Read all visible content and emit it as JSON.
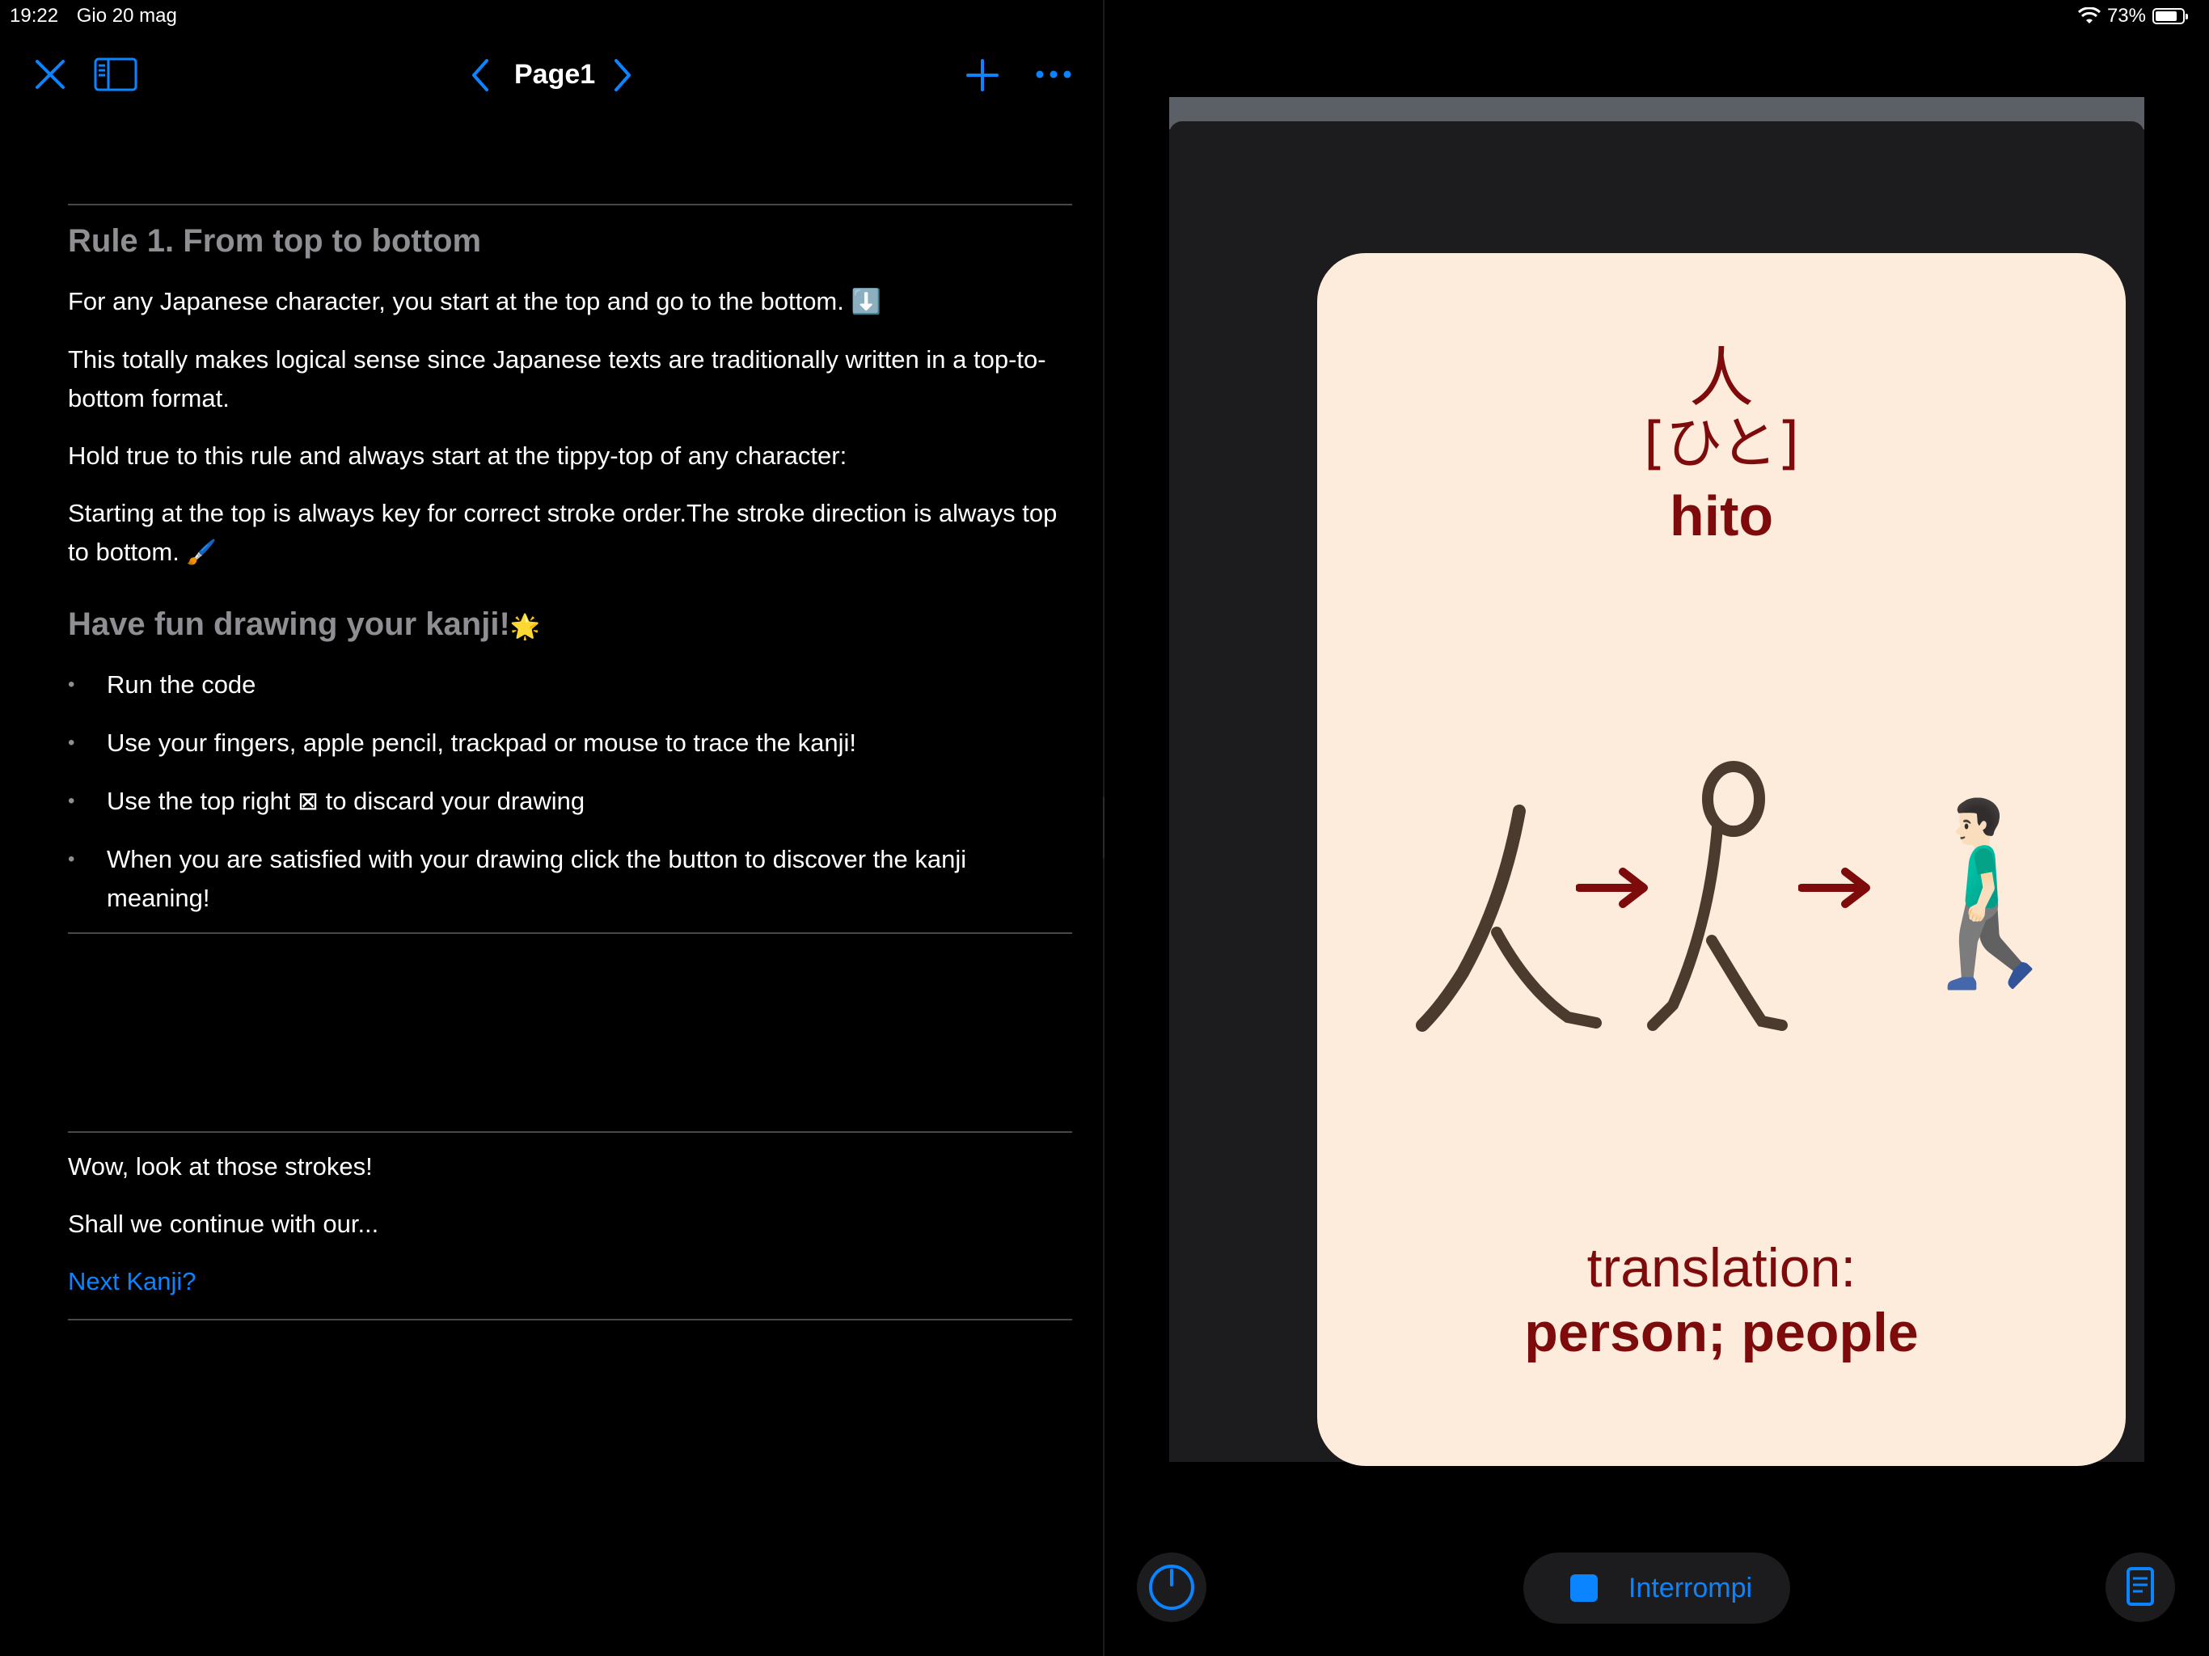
{
  "status": {
    "time": "19:22",
    "date": "Gio 20 mag",
    "battery": "73%"
  },
  "nav": {
    "page_title": "Page1"
  },
  "doc": {
    "heading1": "Rule 1. From top to bottom",
    "p1": "For any Japanese character, you start at the top and go to the bottom.",
    "p1_emoji": "⬇️",
    "p2": "This totally makes logical sense since Japanese texts are traditionally written in a top-to-bottom format.",
    "p3": "Hold true to this rule and always start at the tippy-top of any character:",
    "p4": "Starting at the top is always key for correct stroke order.The stroke direction is always top to bottom.",
    "p4_emoji": "🖌️",
    "heading2": "Have fun drawing your kanji!",
    "heading2_emoji": "🌟",
    "bullets": [
      "Run the code",
      "Use your fingers, apple pencil, trackpad or mouse to trace the kanji!",
      "Use the top right ⊠ to discard your drawing",
      "When you are satisfied with your drawing click the button to discover the kanji meaning!"
    ],
    "outro1": "Wow, look at those strokes!",
    "outro2": "Shall we continue with our...",
    "next_link": "Next Kanji?"
  },
  "card": {
    "kanji": "人",
    "reading": "[ひと]",
    "romaji": "hito",
    "translation_label": "translation:",
    "translation_value": "person; people",
    "emoji_person": "🚶🏻‍♂️"
  },
  "bottom": {
    "stop_label": "Interrompi"
  },
  "colors": {
    "accent": "#0a84ff",
    "card_bg": "#fdebdb",
    "card_text": "#7e0b0b"
  }
}
